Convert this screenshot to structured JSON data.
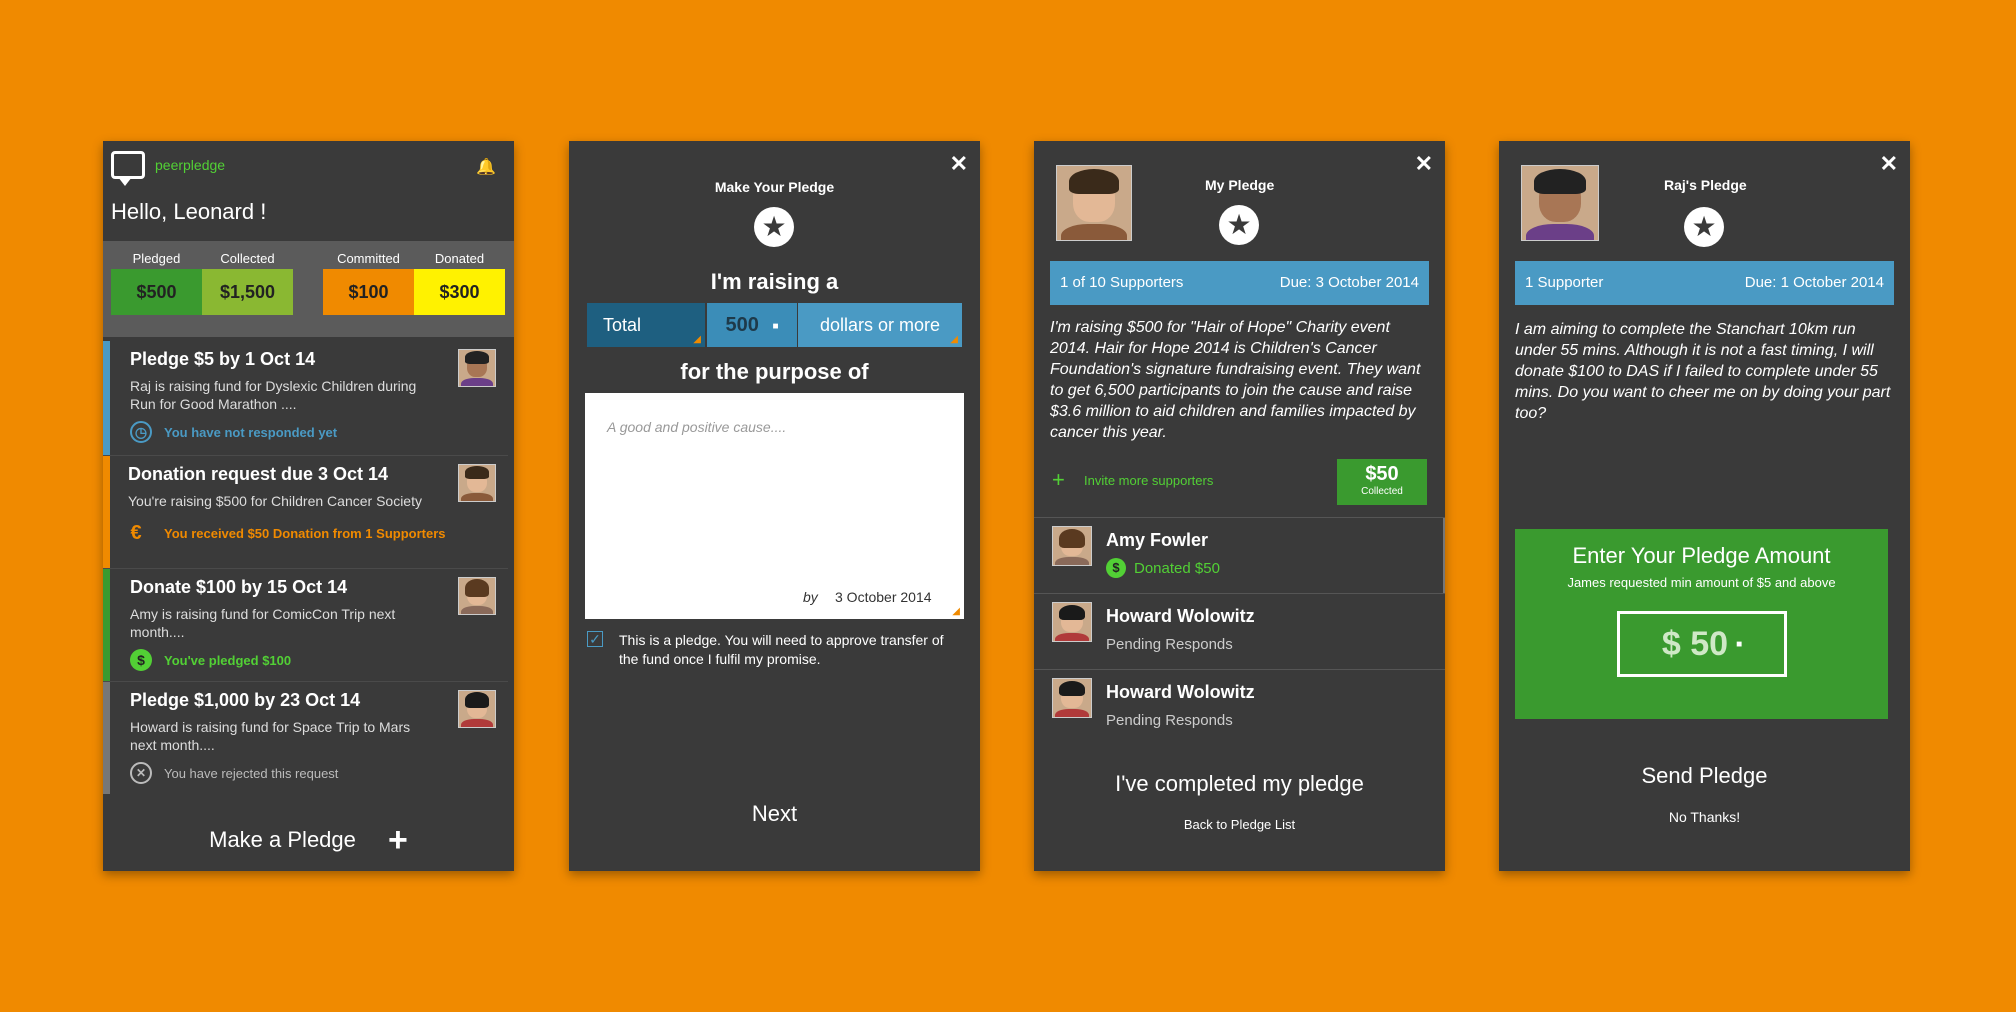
{
  "screen1": {
    "app_name": "peerpledge",
    "greeting": "Hello, Leonard !",
    "stats": [
      {
        "label": "Pledged",
        "value": "$500",
        "color": "#3a9a2f"
      },
      {
        "label": "Collected",
        "value": "$1,500",
        "color": "#8ab832"
      },
      {
        "label": "Committed",
        "value": "$100",
        "color": "#f08a00"
      },
      {
        "label": "Donated",
        "value": "$300",
        "color": "#fff200"
      }
    ],
    "cards": [
      {
        "title": "Pledge $5 by 1 Oct 14",
        "desc": "Raj is raising fund for Dyslexic Children during Run for Good Marathon ....",
        "status": "You have not responded yet",
        "status_color": "#4a9ac4",
        "bar_color": "#4a9ac4",
        "icon": "clock-icon",
        "icon_glyph": "◷"
      },
      {
        "title": "Donation request due 3 Oct 14",
        "desc": "You're raising $500 for Children Cancer Society",
        "status": "You received $50 Donation from 1 Supporters",
        "status_color": "#f08a00",
        "bar_color": "#f08a00",
        "icon": "donation-icon",
        "icon_glyph": "€"
      },
      {
        "title": "Donate $100 by 15 Oct 14",
        "desc": "Amy is raising fund for ComicCon Trip next month....",
        "status": "You've pledged $100",
        "status_color": "#52d035",
        "bar_color": "#3a9a2f",
        "icon": "dollar-icon",
        "icon_glyph": "$"
      },
      {
        "title": "Pledge $1,000 by 23 Oct 14",
        "desc": "Howard is raising fund for Space Trip to Mars next month....",
        "status": "You have rejected this request",
        "status_color": "#bbbbbb",
        "bar_color": "#777777",
        "icon": "reject-icon",
        "icon_glyph": "✕"
      }
    ],
    "make_pledge": "Make a Pledge"
  },
  "screen2": {
    "title": "Make Your Pledge",
    "raising": "I'm raising a",
    "type_select": "Total",
    "amount": "500",
    "unit_select": "dollars or more",
    "purpose": "for the purpose of",
    "placeholder": "A good and positive cause....",
    "by_label": "by",
    "date": "3 October 2014",
    "agreement": "This is a pledge. You will need to approve transfer of the fund once I fulfil my promise.",
    "next": "Next"
  },
  "screen3": {
    "title": "My Pledge",
    "supporters": "1 of 10 Supporters",
    "due": "Due: 3 October 2014",
    "description": "I'm raising $500 for \"Hair of Hope\" Charity event 2014. Hair for Hope 2014 is Children's Cancer Foundation's signature fundraising event. They want to get 6,500 participants to join the cause and raise $3.6 million to aid children and families impacted by cancer this year.",
    "invite": "Invite more supporters",
    "collected_amount": "$50",
    "collected_label": "Collected",
    "supporters_list": [
      {
        "name": "Amy Fowler",
        "status": "Donated $50",
        "donated": true
      },
      {
        "name": "Howard Wolowitz",
        "status": "Pending Responds",
        "donated": false
      },
      {
        "name": "Howard Wolowitz",
        "status": "Pending Responds",
        "donated": false
      }
    ],
    "completed": "I've completed my pledge",
    "back": "Back to Pledge List"
  },
  "screen4": {
    "title": "Raj's Pledge",
    "supporters": "1 Supporter",
    "due": "Due: 1 October 2014",
    "description": "I am aiming to complete the Stanchart 10km run under 55 mins. Although it is not a fast timing, I will donate $100 to DAS if I failed to complete under 55 mins. Do you want to cheer me on by doing your part too?",
    "enter_title": "Enter Your Pledge Amount",
    "min_note": "James requested min amount of $5 and above",
    "amount": "$ 50",
    "send": "Send Pledge",
    "no_thanks": "No Thanks!"
  }
}
